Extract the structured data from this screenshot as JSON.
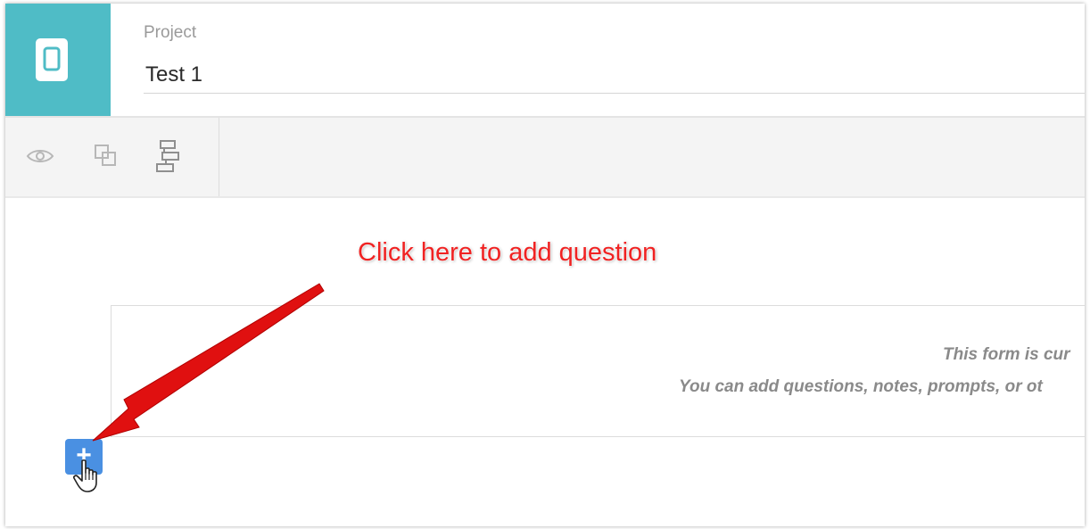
{
  "header": {
    "project_label": "Project",
    "project_name": "Test 1",
    "app_icon": "mobile-device-icon",
    "tile_color": "#4fbcc6"
  },
  "toolbar": {
    "buttons": [
      {
        "name": "preview",
        "icon": "eye-icon"
      },
      {
        "name": "copy",
        "icon": "copy-icon"
      },
      {
        "name": "logic",
        "icon": "flow-logic-icon"
      }
    ]
  },
  "annotation": {
    "text": "Click here to add question",
    "color": "#f02222"
  },
  "form": {
    "empty_line1": "This form is cur",
    "empty_line2": "You can add questions, notes, prompts, or ot"
  },
  "add_button": {
    "label": "+",
    "color": "#4a90e2"
  }
}
